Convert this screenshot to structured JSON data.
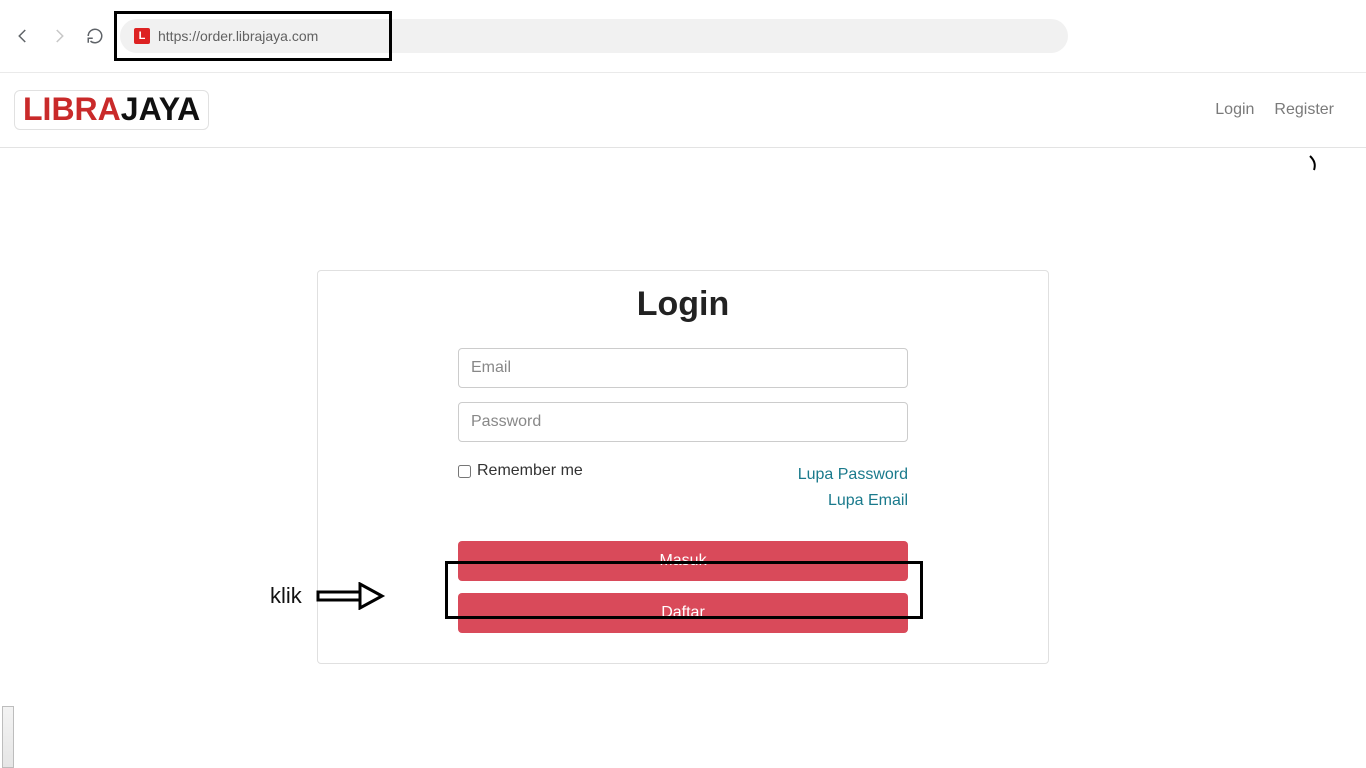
{
  "browser": {
    "url": "https://order.librajaya.com",
    "favicon_letter": "L"
  },
  "header": {
    "logo_part1": "LIBRA",
    "logo_part2": "JAYA",
    "links": {
      "login": "Login",
      "register": "Register"
    }
  },
  "login": {
    "title": "Login",
    "email_placeholder": "Email",
    "password_placeholder": "Password",
    "remember_label": "Remember me",
    "forgot_password": "Lupa Password",
    "forgot_email": "Lupa Email",
    "submit_label": "Masuk",
    "register_label": "Daftar"
  },
  "annotation": {
    "klik_label": "klik"
  }
}
